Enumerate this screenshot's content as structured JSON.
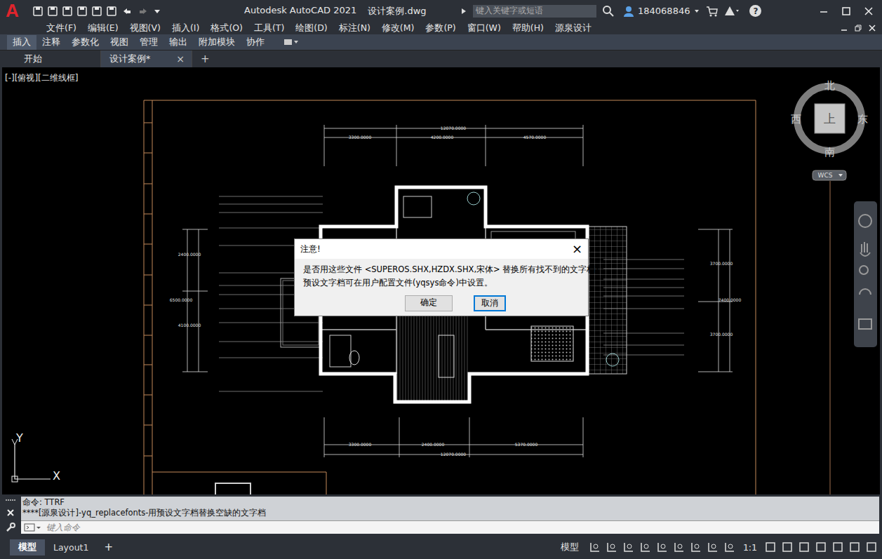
{
  "window": {
    "logo": "A",
    "title": "Autodesk AutoCAD 2021",
    "file": "设计案例.dwg"
  },
  "search": {
    "placeholder": "键入关键字或短语"
  },
  "user": {
    "name": "184068846"
  },
  "help": "?",
  "menu": [
    "文件(F)",
    "编辑(E)",
    "视图(V)",
    "插入(I)",
    "格式(O)",
    "工具(T)",
    "绘图(D)",
    "标注(N)",
    "修改(M)",
    "参数(P)",
    "窗口(W)",
    "帮助(H)",
    "源泉设计"
  ],
  "ribbon_tabs": [
    {
      "label": "插入",
      "selected": true
    },
    {
      "label": "注释",
      "selected": false
    },
    {
      "label": "参数化",
      "selected": false
    },
    {
      "label": "视图",
      "selected": false
    },
    {
      "label": "管理",
      "selected": false
    },
    {
      "label": "输出",
      "selected": false
    },
    {
      "label": "附加模块",
      "selected": false
    },
    {
      "label": "协作",
      "selected": false
    }
  ],
  "file_tabs": [
    {
      "label": "开始",
      "selected": false,
      "closable": false
    },
    {
      "label": "设计案例*",
      "selected": true,
      "closable": true
    }
  ],
  "file_tab_close": "×",
  "new_tab": "+",
  "viewport": {
    "label": "[-][俯视][二维线框]"
  },
  "viewcube": {
    "north": "北",
    "south": "南",
    "west": "西",
    "east": "东",
    "top": "上",
    "wcs": "WCS"
  },
  "ucs": {
    "x": "X",
    "y": "Y"
  },
  "dimensions": {
    "top": [
      "3300.0000",
      "4200.0000",
      "4570.0000"
    ],
    "top_total": "12070.0000",
    "bottom": [
      "3300.0000",
      "2400.0000",
      "5370.0000"
    ],
    "bottom_total": "12070.0000",
    "left": [
      "2400.0000",
      "4100.0000"
    ],
    "left_total": "6500.0000",
    "right": [
      "3700.0000",
      "3700.0000"
    ],
    "right_total": "7400.0000"
  },
  "dialog": {
    "title": "注意!",
    "close": "×",
    "message": [
      "是否用这些文件 <SUPEROS.SHX,HZDX.SHX,宋体> 替换所有找不到的文字档?",
      "预设文字档可在用户配置文件(yqsys命令)中设置。"
    ],
    "buttons": [
      {
        "label": "确定",
        "selected": false
      },
      {
        "label": "取消",
        "selected": true
      }
    ]
  },
  "command_line": {
    "history": [
      "命令: TTRF",
      "****[源泉设计]-yq_replacefonts-用预设文字档替换空缺的文字档"
    ],
    "placeholder": "键入命令"
  },
  "layout_tabs": [
    {
      "label": "模型",
      "selected": true
    },
    {
      "label": "Layout1",
      "selected": false
    }
  ],
  "layout_add": "+",
  "status_bar": {
    "space": "模型",
    "scale": "1:1"
  }
}
